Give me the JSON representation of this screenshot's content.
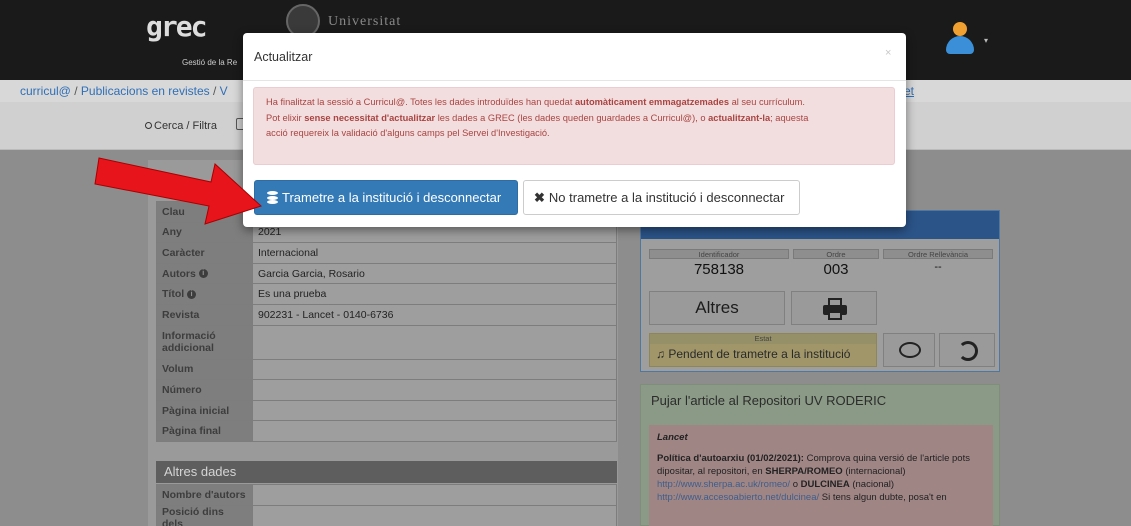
{
  "header": {
    "logo_text": "grec",
    "logo_subtitle": "Gestió de la Re",
    "university_name": "Universitat",
    "user_caret": "▾"
  },
  "breadcrumb": {
    "items": [
      "curricul@",
      "Publicacions en revistes",
      "V"
    ],
    "separator": "/",
    "right_link": "et"
  },
  "toolbar": {
    "search_label": "Cerca / Filtra"
  },
  "form": {
    "rows": [
      {
        "label": "Clau",
        "value": ""
      },
      {
        "label": "Any",
        "value": "2021"
      },
      {
        "label": "Caràcter",
        "value": "Internacional"
      },
      {
        "label": "Autors",
        "value": "Garcia Garcia, Rosario",
        "info": true
      },
      {
        "label": "Títol",
        "value": "Es una prueba",
        "info": true
      },
      {
        "label": "Revista",
        "value": "902231 - Lancet - 0140-6736"
      },
      {
        "label": "Informació addicional",
        "value": ""
      },
      {
        "label": "Volum",
        "value": ""
      },
      {
        "label": "Número",
        "value": ""
      },
      {
        "label": "Pàgina inicial",
        "value": ""
      },
      {
        "label": "Pàgina final",
        "value": ""
      }
    ],
    "altres_dades_title": "Altres dades",
    "altres_rows": [
      {
        "label": "Nombre d'autors",
        "value": ""
      },
      {
        "label": "Posició dins dels",
        "value": ""
      }
    ]
  },
  "status_panel": {
    "identificador_label": "Identificador",
    "identificador_value": "758138",
    "ordre_label": "Ordre",
    "ordre_value": "003",
    "rellevancia_label": "Ordre Rellevància",
    "rellevancia_value": "--",
    "altres_button": "Altres",
    "estat_label": "Estat",
    "estat_value": "Pendent de trametre a la institució"
  },
  "roderic": {
    "title": "Pujar l'article al Repositori UV RODERIC",
    "journal": "Lancet",
    "policy_bold": "Política d'autoarxiu (01/02/2021):",
    "policy_text": " Comprova quina versió de l'article pots dipositar, al repositori, en ",
    "sherpa": "SHERPA/ROMEO",
    "sherpa_note": " (internacional) ",
    "sherpa_link": "http://www.sherpa.ac.uk/romeo/",
    "o": " o ",
    "dulcinea": "DULCINEA",
    "dulcinea_note": " (nacional)",
    "dulcinea_link": "http://www.accesoabierto.net/dulcinea/",
    "doubt_text": " Si tens algun dubte, posa't en"
  },
  "modal": {
    "title": "Actualitzar",
    "close": "×",
    "alert_line1_pre": "Ha finalitzat la sessió a Curricul@. Totes les dades introduïdes han quedat ",
    "alert_line1_bold": "automàticament emmagatzemades",
    "alert_line1_post": " al seu currículum.",
    "alert_line2_pre": "Pot elixir ",
    "alert_line2_bold1": "sense necessitat d'actualitzar",
    "alert_line2_mid": " les dades a GREC (les dades queden guardades a Curricul@), o ",
    "alert_line2_bold2": "actualitzant-la",
    "alert_line2_post": "; aquesta",
    "alert_line3": "acció requereix la validació d'alguns camps pel Servei d'Investigació.",
    "primary_button": "Trametre a la institució i desconnectar",
    "secondary_button": "No trametre a la institució i desconnectar"
  },
  "colors": {
    "primary": "#337ab7",
    "alert_bg": "#f2dede",
    "alert_text": "#a94442",
    "arrow": "#e8141c"
  }
}
